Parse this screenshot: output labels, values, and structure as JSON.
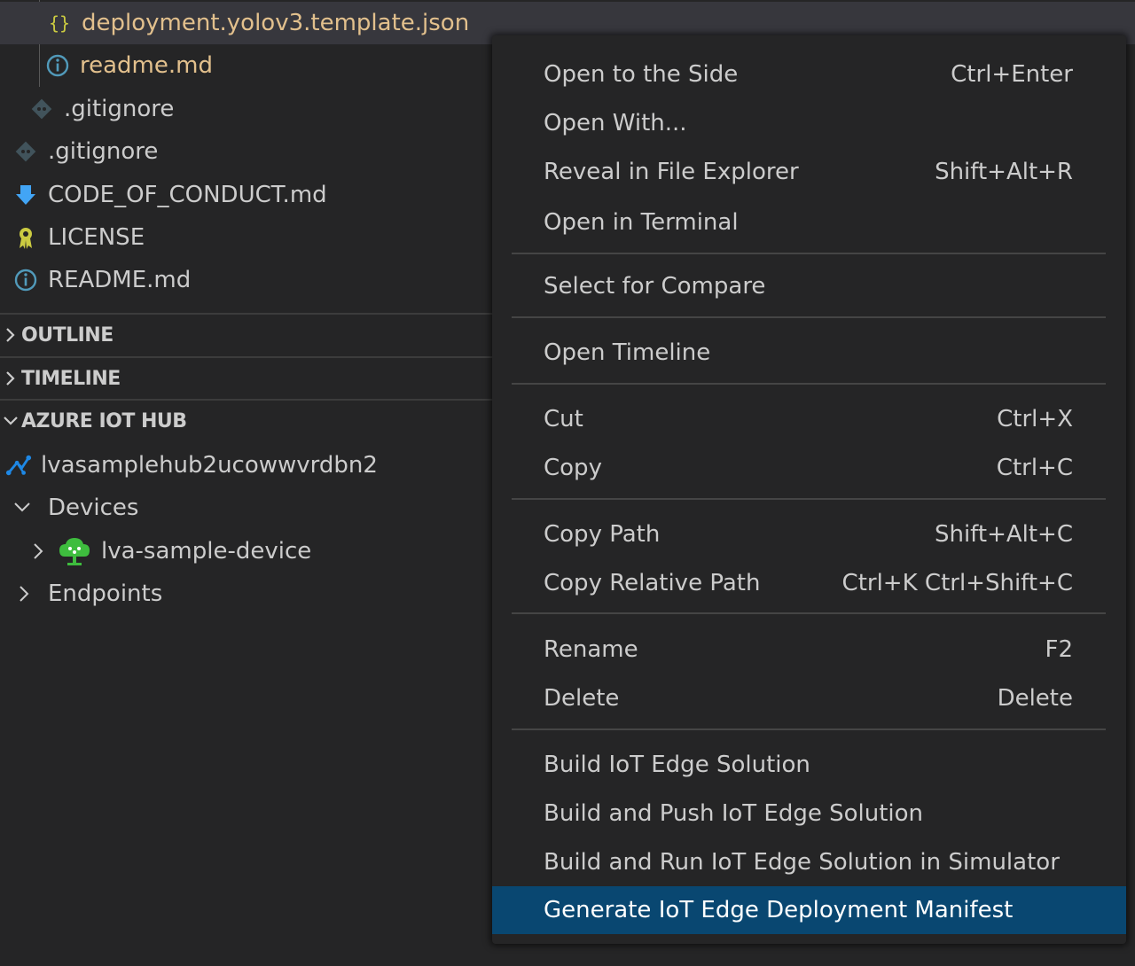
{
  "explorer": {
    "files": [
      {
        "label": "deployment.yolov3.template.json",
        "icon": "json-braces-icon"
      },
      {
        "label": "readme.md",
        "icon": "info-icon"
      },
      {
        "label": ".gitignore",
        "icon": "git-icon"
      },
      {
        "label": ".gitignore",
        "icon": "git-icon"
      },
      {
        "label": "CODE_OF_CONDUCT.md",
        "icon": "markdown-arrow-icon"
      },
      {
        "label": "LICENSE",
        "icon": "license-ribbon-icon"
      },
      {
        "label": "README.md",
        "icon": "info-icon"
      }
    ],
    "sections": {
      "outline": "OUTLINE",
      "timeline": "TIMELINE",
      "azure_iot_hub": "AZURE IOT HUB"
    },
    "iot_hub": {
      "hub_name": "lvasamplehub2ucowwvrdbn2",
      "devices_label": "Devices",
      "device_name": "lva-sample-device",
      "endpoints_label": "Endpoints"
    }
  },
  "context_menu": {
    "items": [
      {
        "label": "Open to the Side",
        "shortcut": "Ctrl+Enter"
      },
      {
        "label": "Open With...",
        "shortcut": ""
      },
      {
        "label": "Reveal in File Explorer",
        "shortcut": "Shift+Alt+R"
      },
      {
        "label": "Open in Terminal",
        "shortcut": ""
      },
      {
        "label": "Select for Compare",
        "shortcut": ""
      },
      {
        "label": "Open Timeline",
        "shortcut": ""
      },
      {
        "label": "Cut",
        "shortcut": "Ctrl+X"
      },
      {
        "label": "Copy",
        "shortcut": "Ctrl+C"
      },
      {
        "label": "Copy Path",
        "shortcut": "Shift+Alt+C"
      },
      {
        "label": "Copy Relative Path",
        "shortcut": "Ctrl+K Ctrl+Shift+C"
      },
      {
        "label": "Rename",
        "shortcut": "F2"
      },
      {
        "label": "Delete",
        "shortcut": "Delete"
      },
      {
        "label": "Build IoT Edge Solution",
        "shortcut": ""
      },
      {
        "label": "Build and Push IoT Edge Solution",
        "shortcut": ""
      },
      {
        "label": "Build and Run IoT Edge Solution in Simulator",
        "shortcut": ""
      },
      {
        "label": "Generate IoT Edge Deployment Manifest",
        "shortcut": ""
      }
    ],
    "highlighted_item": "Generate IoT Edge Deployment Manifest"
  },
  "colors": {
    "background": "#252526",
    "highlight": "#094771",
    "selected_row": "#37373d",
    "modified_file_text": "#e2c08d",
    "json_icon": "#cbcb41",
    "info_icon": "#519aba",
    "git_icon": "#41535b",
    "markdown_icon": "#42a5f5",
    "license_icon": "#cbcb41",
    "iot_device_icon": "#3ebd3e",
    "iot_hub_icon": "#1e88e5"
  }
}
